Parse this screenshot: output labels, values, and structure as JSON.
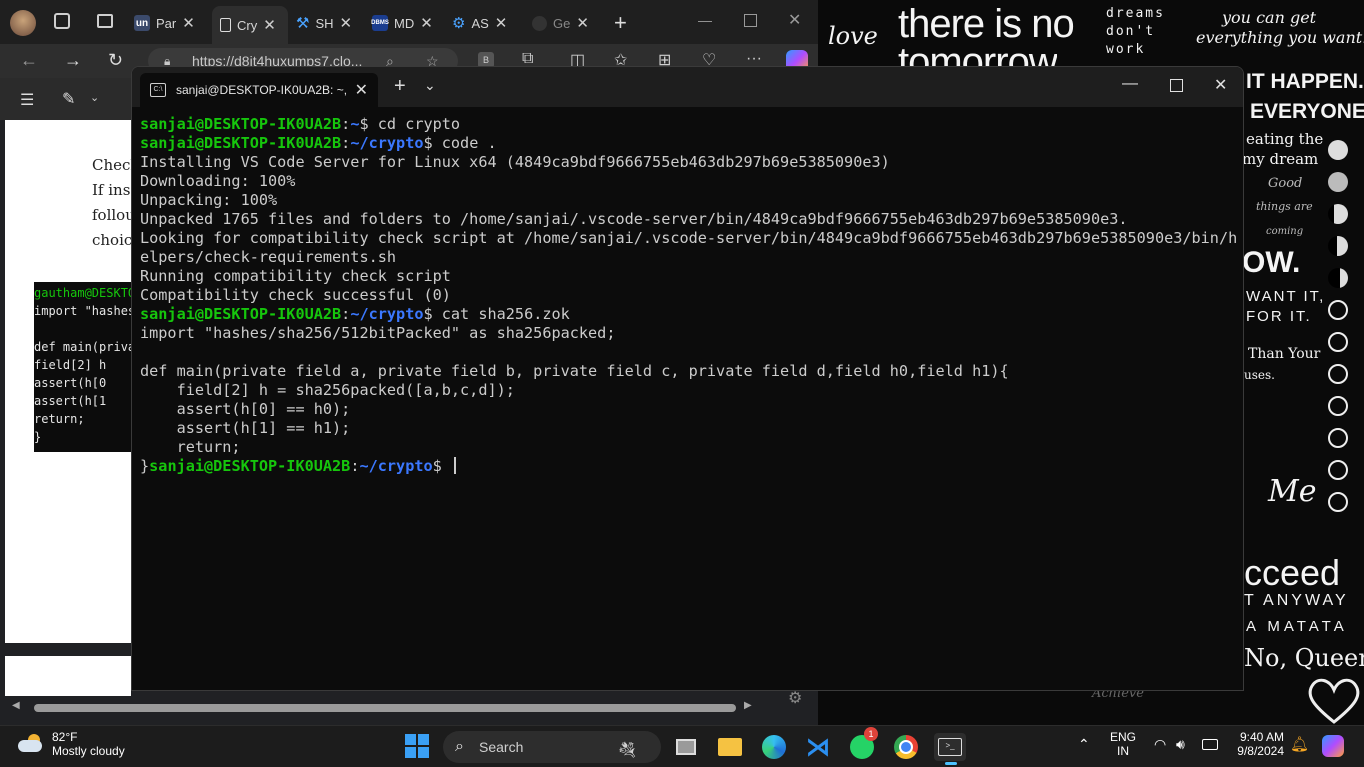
{
  "browser": {
    "tabs": [
      {
        "label": "Par",
        "icon": "un",
        "color": "#3b4a6b"
      },
      {
        "label": "Cry",
        "icon": "page-icon",
        "color": "#444"
      },
      {
        "label": "SH",
        "icon": "tools-icon",
        "color": "#2b7de9"
      },
      {
        "label": "MD",
        "icon": "DBMS",
        "color": "#1b3d8f"
      },
      {
        "label": "AS",
        "icon": "gear-icon",
        "color": "#2b7de9"
      },
      {
        "label": "Ge",
        "icon": "github-icon",
        "color": "#333"
      }
    ],
    "url": "https://d8it4huxumps7.clo...",
    "page_text": [
      "Check",
      "If ins",
      "follou",
      "choic"
    ],
    "code_lines": [
      "gautham@DESKTO",
      "import \"hashes",
      "",
      "def main(priva",
      "   field[2] h",
      "   assert(h[0",
      "   assert(h[1",
      "   return;",
      "}"
    ]
  },
  "terminal": {
    "tab_title": "sanjai@DESKTOP-IK0UA2B: ~,",
    "lines": [
      [
        {
          "t": "sanjai@DESKTOP-IK0UA2B",
          "c": "g"
        },
        {
          "t": ":",
          "c": ""
        },
        {
          "t": "~",
          "c": "b"
        },
        {
          "t": "$ cd crypto",
          "c": ""
        }
      ],
      [
        {
          "t": "sanjai@DESKTOP-IK0UA2B",
          "c": "g"
        },
        {
          "t": ":",
          "c": ""
        },
        {
          "t": "~/crypto",
          "c": "b"
        },
        {
          "t": "$ code .",
          "c": ""
        }
      ],
      [
        {
          "t": "Installing VS Code Server for Linux x64 (4849ca9bdf9666755eb463db297b69e5385090e3)",
          "c": ""
        }
      ],
      [
        {
          "t": "Downloading: 100%",
          "c": ""
        }
      ],
      [
        {
          "t": "Unpacking: 100%",
          "c": ""
        }
      ],
      [
        {
          "t": "Unpacked 1765 files and folders to /home/sanjai/.vscode-server/bin/4849ca9bdf9666755eb463db297b69e5385090e3.",
          "c": ""
        }
      ],
      [
        {
          "t": "Looking for compatibility check script at /home/sanjai/.vscode-server/bin/4849ca9bdf9666755eb463db297b69e5385090e3/bin/h",
          "c": ""
        }
      ],
      [
        {
          "t": "elpers/check-requirements.sh",
          "c": ""
        }
      ],
      [
        {
          "t": "Running compatibility check script",
          "c": ""
        }
      ],
      [
        {
          "t": "Compatibility check successful (0)",
          "c": ""
        }
      ],
      [
        {
          "t": "sanjai@DESKTOP-IK0UA2B",
          "c": "g"
        },
        {
          "t": ":",
          "c": ""
        },
        {
          "t": "~/crypto",
          "c": "b"
        },
        {
          "t": "$ cat sha256.zok",
          "c": ""
        }
      ],
      [
        {
          "t": "import \"hashes/sha256/512bitPacked\" as sha256packed;",
          "c": ""
        }
      ],
      [
        {
          "t": "",
          "c": ""
        }
      ],
      [
        {
          "t": "def main(private field a, private field b, private field c, private field d,field h0,field h1){",
          "c": ""
        }
      ],
      [
        {
          "t": "    field[2] h = sha256packed([a,b,c,d]);",
          "c": ""
        }
      ],
      [
        {
          "t": "    assert(h[0] == h0);",
          "c": ""
        }
      ],
      [
        {
          "t": "    assert(h[1] == h1);",
          "c": ""
        }
      ],
      [
        {
          "t": "    return;",
          "c": ""
        }
      ],
      [
        {
          "t": "}",
          "c": ""
        },
        {
          "t": "sanjai@DESKTOP-IK0UA2B",
          "c": "g"
        },
        {
          "t": ":",
          "c": ""
        },
        {
          "t": "~/crypto",
          "c": "b"
        },
        {
          "t": "$ ",
          "c": ""
        }
      ]
    ]
  },
  "wallpaper": {
    "texts": [
      "love",
      "there is no",
      "tomorrow",
      "dreams",
      "don't",
      "work",
      "you can get",
      "everything you want.",
      "IT HAPPEN.",
      "EVERYONE.",
      "eating the",
      "my dream",
      "Good",
      "things are",
      "coming",
      "OW.",
      "WANT IT,",
      "FOR IT.",
      "Than Your",
      "uses.",
      "Me",
      "cceed",
      "T ANYWAY",
      "A MATATA",
      "No, Queen",
      "Achieve"
    ]
  },
  "taskbar": {
    "temperature": "82°F",
    "condition": "Mostly cloudy",
    "search_placeholder": "Search",
    "language": "ENG",
    "region": "IN",
    "time": "9:40 AM",
    "date": "9/8/2024",
    "whatsapp_badge": "1"
  }
}
